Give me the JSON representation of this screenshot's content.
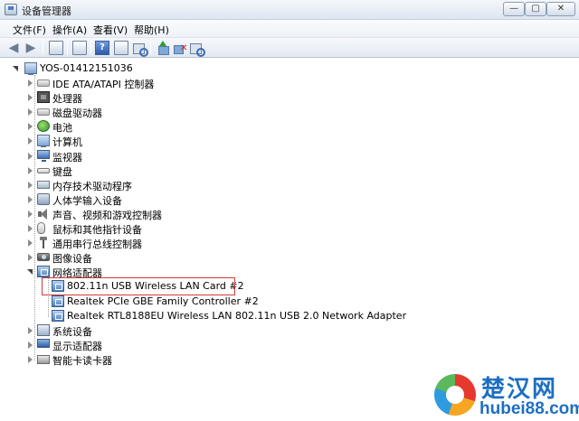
{
  "window": {
    "title": "设备管理器",
    "controls": {
      "minimize": "—",
      "maximize": "▢",
      "close": "✕"
    }
  },
  "menu": [
    "文件(F)",
    "操作(A)",
    "查看(V)",
    "帮助(H)"
  ],
  "toolbar": {
    "buttons": [
      "back-icon",
      "forward-icon",
      "properties-icon",
      "console-tree-icon",
      "help-icon",
      "view-icon",
      "scan-icon",
      "update-driver-icon",
      "disable-icon",
      "uninstall-icon"
    ]
  },
  "tree": {
    "root": "YOS-01412151036",
    "categories": [
      "IDE ATA/ATAPI 控制器",
      "处理器",
      "磁盘驱动器",
      "电池",
      "计算机",
      "监视器",
      "键盘",
      "内存技术驱动程序",
      "人体学输入设备",
      "声音、视频和游戏控制器",
      "鼠标和其他指针设备",
      "通用串行总线控制器",
      "图像设备",
      "网络适配器"
    ],
    "network_children": [
      "802.11n USB Wireless LAN Card #2",
      "Realtek PCIe GBE Family Controller #2",
      "Realtek RTL8188EU Wireless LAN 802.11n USB 2.0 Network Adapter"
    ],
    "after_categories": [
      "系统设备",
      "显示适配器",
      "智能卡读卡器"
    ]
  },
  "watermark": {
    "brand": "楚汉网",
    "url": "hubei88.com"
  },
  "colors": {
    "highlight": "#d23a3a",
    "brand": "#1d6fc2"
  }
}
